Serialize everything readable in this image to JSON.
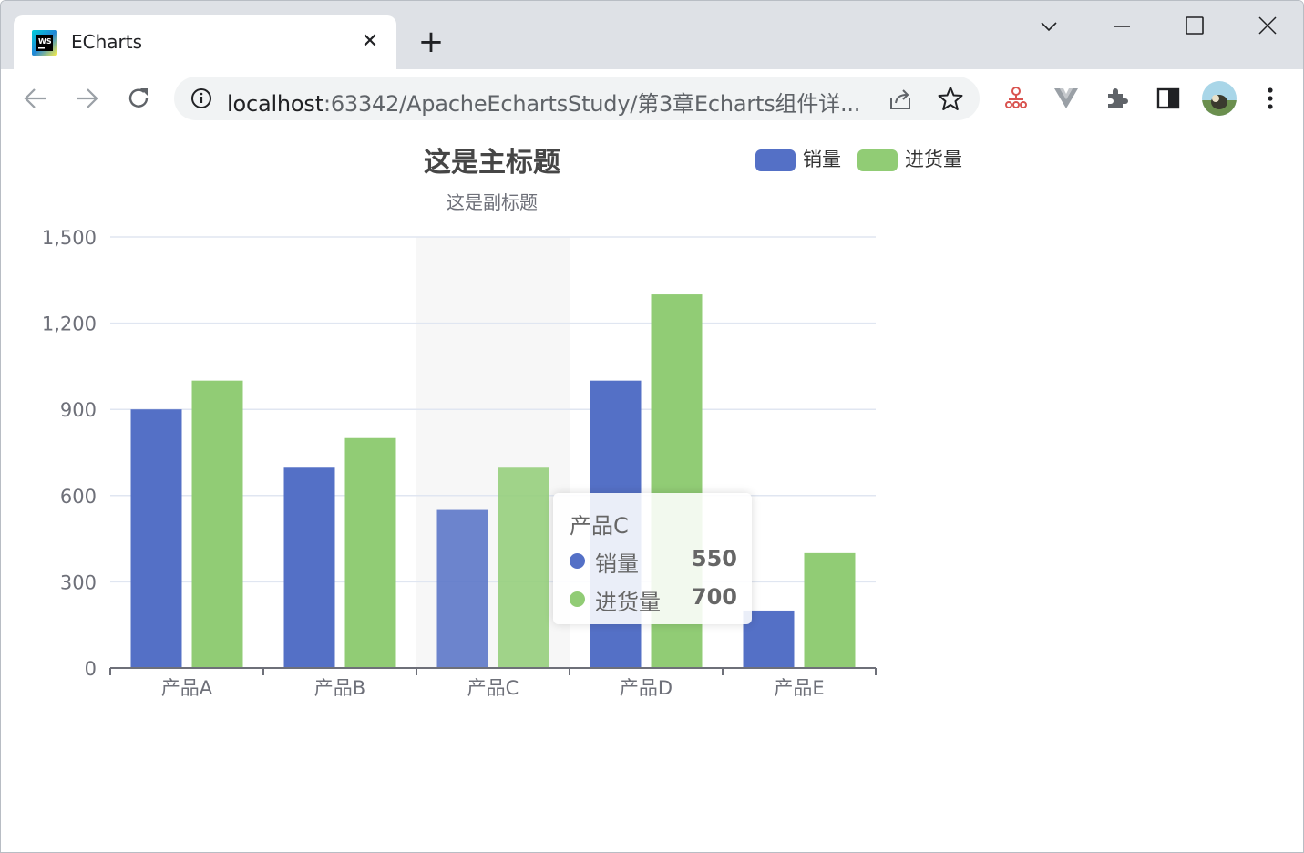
{
  "browser": {
    "tab_title": "ECharts",
    "url_host": "localhost",
    "url_rest": ":63342/ApacheEchartsStudy/第3章Echarts组件详..."
  },
  "colors": {
    "series1": "#5470c6",
    "series2": "#91cc75",
    "axis": "#6e7079",
    "grid": "#e0e6f1",
    "title": "#464646",
    "subtitle": "#6e7079"
  },
  "chart_data": {
    "type": "bar",
    "title": "这是主标题",
    "subtitle": "这是副标题",
    "categories": [
      "产品A",
      "产品B",
      "产品C",
      "产品D",
      "产品E"
    ],
    "series": [
      {
        "name": "销量",
        "values": [
          900,
          700,
          550,
          1000,
          200
        ]
      },
      {
        "name": "进货量",
        "values": [
          1000,
          800,
          700,
          1300,
          400
        ]
      }
    ],
    "ylim": [
      0,
      1500
    ],
    "yticks": [
      "0",
      "300",
      "600",
      "900",
      "1,200",
      "1,500"
    ],
    "ytick_values": [
      0,
      300,
      600,
      900,
      1200,
      1500
    ],
    "grid": true,
    "legend": "top-right",
    "highlighted_category": "产品C"
  },
  "tooltip": {
    "title": "产品C",
    "rows": [
      {
        "name": "销量",
        "value": "550"
      },
      {
        "name": "进货量",
        "value": "700"
      }
    ]
  }
}
